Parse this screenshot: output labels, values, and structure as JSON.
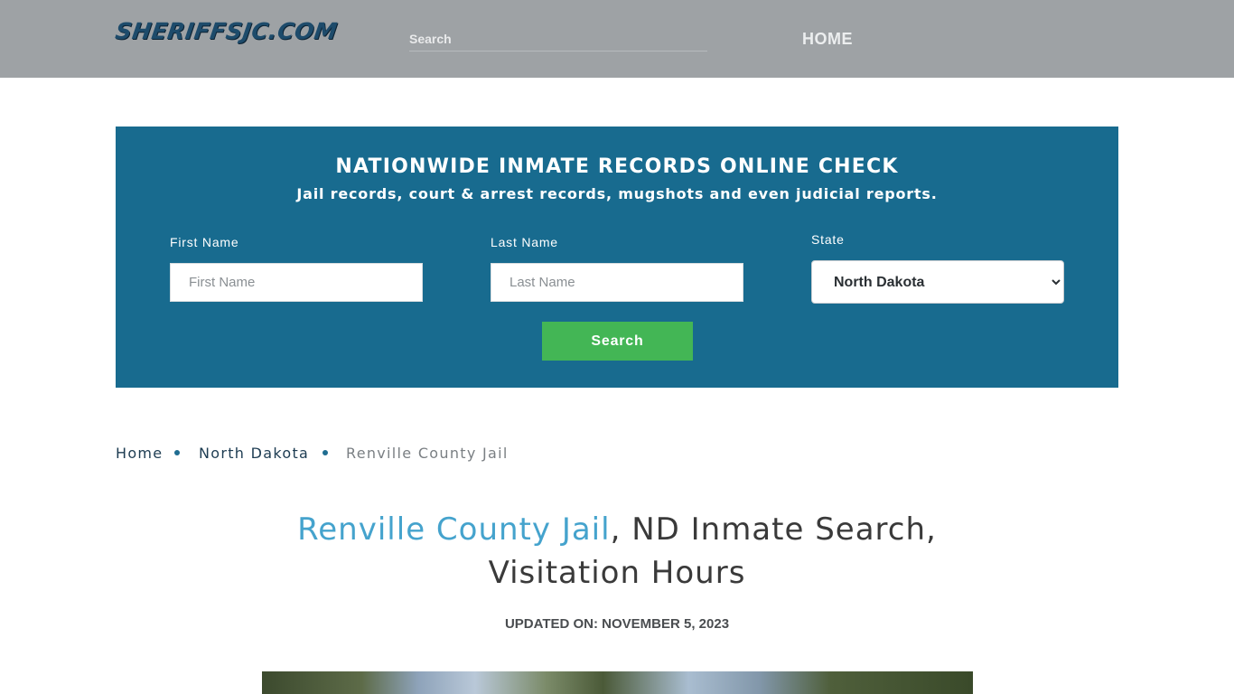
{
  "header": {
    "logo_text": "SHERIFFSJC.COM",
    "search_placeholder": "Search",
    "nav_home": "HOME"
  },
  "search_panel": {
    "title": "NATIONWIDE INMATE RECORDS ONLINE CHECK",
    "subtitle": "Jail records, court & arrest records, mugshots and even judicial reports.",
    "first_name_label": "First Name",
    "first_name_placeholder": "First Name",
    "last_name_label": "Last Name",
    "last_name_placeholder": "Last Name",
    "state_label": "State",
    "state_selected": "North Dakota",
    "search_button": "Search"
  },
  "breadcrumb": {
    "items": [
      "Home",
      "North Dakota",
      "Renville County Jail"
    ]
  },
  "article": {
    "title_link": "Renville County Jail",
    "title_rest_line1": ", ND Inmate Search,",
    "title_line2": "Visitation Hours",
    "updated": "UPDATED ON: NOVEMBER 5, 2023"
  },
  "colors": {
    "header_bg": "#9ea2a5",
    "panel_bg": "#186b8f",
    "button_bg": "#43b655",
    "title_link": "#45a3cd"
  }
}
